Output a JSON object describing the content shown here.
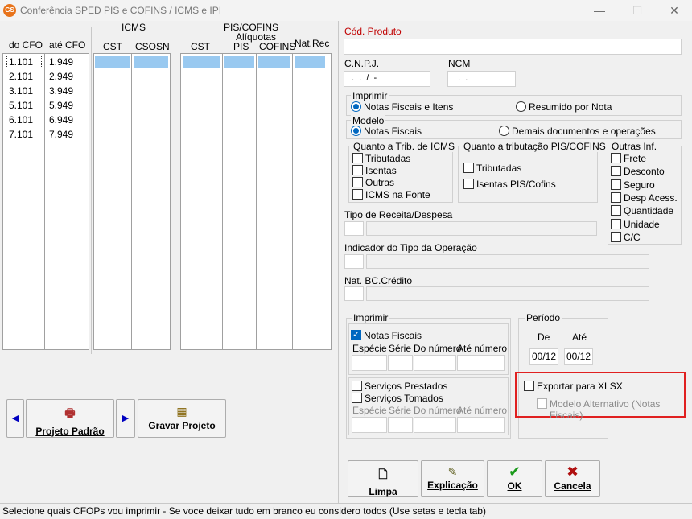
{
  "window": {
    "title": "Conferência SPED PIS e COFINS / ICMS e IPI",
    "icon_text": "GS",
    "minimize": "—",
    "maximize": "☐",
    "close": "✕"
  },
  "cfo_grid": {
    "col_from": "do CFO",
    "col_to": "até CFO",
    "rows": [
      {
        "from": "1.101",
        "to": "1.949"
      },
      {
        "from": "2.101",
        "to": "2.949"
      },
      {
        "from": "3.101",
        "to": "3.949"
      },
      {
        "from": "5.101",
        "to": "5.949"
      },
      {
        "from": "6.101",
        "to": "6.949"
      },
      {
        "from": "7.101",
        "to": "7.949"
      }
    ]
  },
  "icms_grid": {
    "group": "ICMS",
    "col_cst": "CST",
    "col_csosn": "CSOSN"
  },
  "pis_grid": {
    "group": "PIS/COFINS",
    "subgroup": "Alíquotas",
    "col_cst": "CST",
    "col_pis": "PIS",
    "col_cofins": "COFINS",
    "col_natrec": "Nat.Rec"
  },
  "project": {
    "prev_arrow": "◀",
    "next_arrow": "▶",
    "default_label": "Projeto Padrão",
    "save_label": "Gravar Projeto"
  },
  "form": {
    "cod_produto_label": "Cód. Produto",
    "cnpj_label": "C.N.P.J.",
    "cnpj_value": " .  .  /  -",
    "ncm_label": "NCM",
    "ncm_value": "  .  .",
    "imprimir_title": "Imprimir",
    "imprimir_opt1": "Notas Fiscais e Itens",
    "imprimir_opt2": "Resumido por Nota",
    "modelo_title": "Modelo",
    "modelo_opt1": "Notas Fiscais",
    "modelo_opt2": "Demais documentos e operações",
    "icms_trib_title": "Quanto a Trib. de ICMS",
    "icms_tributadas": "Tributadas",
    "icms_isentas": "Isentas",
    "icms_outras": "Outras",
    "icms_fonte": "ICMS na Fonte",
    "pis_trib_title": "Quanto a tributação PIS/COFINS",
    "pis_tributadas": "Tributadas",
    "pis_isentas": "Isentas PIS/Cofins",
    "outras_title": "Outras Inf.",
    "outras_items": [
      "Frete",
      "Desconto",
      "Seguro",
      "Desp Acess.",
      "Quantidade",
      "Unidade",
      "C/C"
    ],
    "tipo_receita_label": "Tipo de Receita/Despesa",
    "indicador_label": "Indicador do Tipo da Operação",
    "nat_bc_label": "Nat. BC.Crédito",
    "imprimir2_title": "Imprimir",
    "nf_label": "Notas Fiscais",
    "especie": "Espécie",
    "serie": "Série",
    "do_numero": "Do número",
    "ate_numero": "Até número",
    "servicos_prestados": "Serviços Prestados",
    "servicos_tomados": "Serviços Tomados",
    "periodo_title": "Período",
    "de_label": "De",
    "ate_label": "Até",
    "de_value": "00/12",
    "ate_value": "00/12",
    "exportar_xlsx": "Exportar para XLSX",
    "modelo_alternativo": "Modelo Alternativo (Notas Fiscais)"
  },
  "actions": {
    "limpa": "Limpa",
    "explicacao": "Explicação",
    "ok": "OK",
    "cancela": "Cancela"
  },
  "status": "Selecione quais CFOPs vou imprimir - Se voce deixar tudo em branco eu considero todos (Use setas e tecla tab)",
  "colors": {
    "accent": "#0067c0",
    "selection": "#99c9f0",
    "red_label": "#c00000",
    "highlight": "#e02020"
  }
}
